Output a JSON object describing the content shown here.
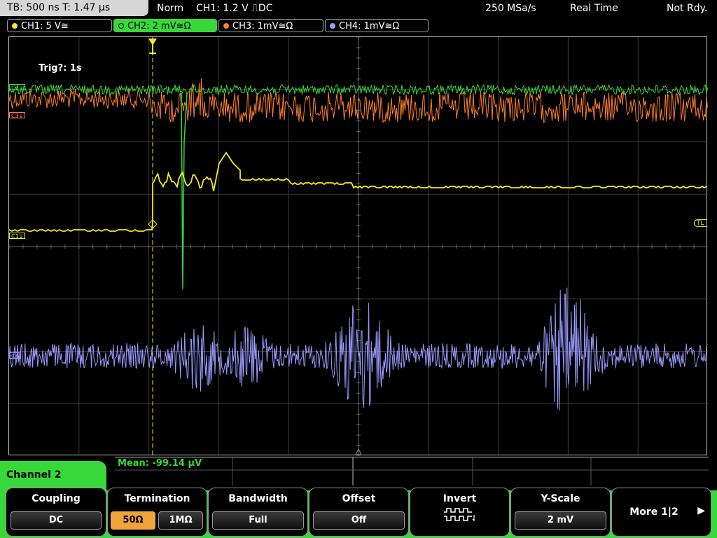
{
  "status": {
    "timebase": "TB: 500 ns   T: 1.47 µs",
    "mode": "Norm",
    "trigger": "CH1: 1.2 V ⎍DC",
    "sample_rate": "250 MSa/s",
    "acq_mode": "Real Time",
    "ready": "Not Rdy."
  },
  "channels": [
    {
      "label": "CH1: 5 V≅",
      "color": "#f5ea1e"
    },
    {
      "label": "CH2: 2 mV≅Ω",
      "color": "#38d83a"
    },
    {
      "label": "CH3: 1mV≅Ω",
      "color": "#ff7f2a"
    },
    {
      "label": "CH4: 1mV≅Ω",
      "color": "#9a9aff"
    }
  ],
  "plot": {
    "trig_info": "Trig?: 1s",
    "markers": {
      "c3": "C3↓",
      "c1": "C1↓",
      "c4": "C4",
      "tl": "TL"
    }
  },
  "measurement": {
    "mean": "Mean: -99.14 µV"
  },
  "menu": {
    "title": "Channel 2",
    "coupling": {
      "title": "Coupling",
      "value": "DC"
    },
    "termination": {
      "title": "Termination",
      "opt1": "50Ω",
      "opt2": "1MΩ"
    },
    "bandwidth": {
      "title": "Bandwidth",
      "value": "Full"
    },
    "offset": {
      "title": "Offset",
      "value": "Off"
    },
    "invert": {
      "title": "Invert",
      "icon": "invert-waveform-icon"
    },
    "yscale": {
      "title": "Y-Scale",
      "value": "2 mV"
    },
    "more": {
      "title": "More 1|2",
      "icon": "arrow-right-icon"
    }
  }
}
